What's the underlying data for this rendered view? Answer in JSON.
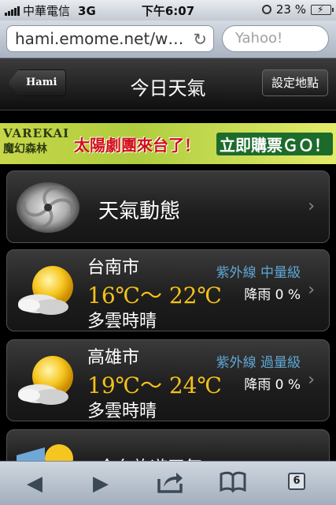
{
  "status": {
    "carrier": "中華電信",
    "network": "3G",
    "time": "下午6:07",
    "battery": "23 %",
    "battery_level": 0.23
  },
  "browser": {
    "url": "hami.emome.net/weat…",
    "search_placeholder": "Yahoo!"
  },
  "nav": {
    "back_label": "Hami",
    "title": "今日天氣",
    "settings_label": "設定地點"
  },
  "banner": {
    "logo_line1": "VAREKAI",
    "logo_line2": "魔幻森林",
    "slogan": "太陽劇團來台了！",
    "cta": "立即購票ＧＯ！"
  },
  "items": {
    "dynamic_label": "天氣動態",
    "cities": [
      {
        "city": "台南市",
        "temp": "16℃～ 22℃",
        "condition": "多雲時晴",
        "uv": "紫外線  中量級",
        "rain": "降雨 0 %"
      },
      {
        "city": "高雄市",
        "temp": "19℃～ 24℃",
        "condition": "多雲時晴",
        "uv": "紫外線  過量級",
        "rain": "降雨 0 %"
      }
    ],
    "partial_label": "全台旅遊天氣"
  },
  "toolbar": {
    "tabs_count": "6"
  },
  "colors": {
    "temperature": "#f4c11a",
    "uv_text": "#5fa6d4",
    "battery_fill": "#3bb43b"
  }
}
